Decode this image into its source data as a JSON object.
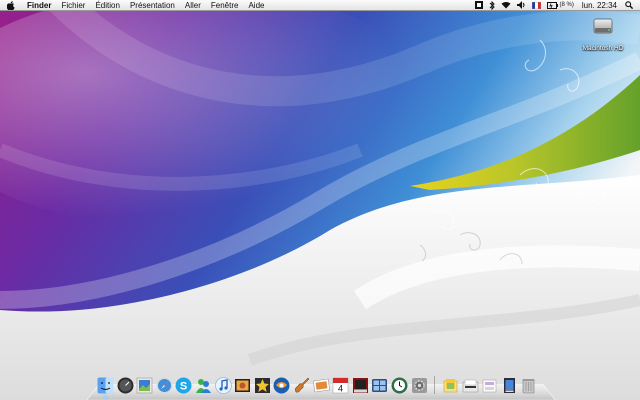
{
  "menubar": {
    "apple_icon": "apple-icon",
    "app_name": "Finder",
    "menus": [
      "Fichier",
      "Édition",
      "Présentation",
      "Aller",
      "Fenêtre",
      "Aide"
    ],
    "battery_text": "(8 %)",
    "clock": "lun. 22:34",
    "status_icons": [
      "scripts-icon",
      "bluetooth-icon",
      "wifi-icon",
      "volume-icon",
      "flag-fr-icon",
      "battery-icon",
      "spotlight-icon"
    ]
  },
  "desktop": {
    "icons": [
      {
        "label": "Macintosh HD",
        "icon": "hard-drive-icon"
      }
    ]
  },
  "dock": {
    "apps": [
      {
        "name": "finder-icon",
        "running": true
      },
      {
        "name": "dashboard-icon",
        "running": false
      },
      {
        "name": "preview-icon",
        "running": false
      },
      {
        "name": "safari-icon",
        "running": false
      },
      {
        "name": "skype-icon",
        "running": false
      },
      {
        "name": "messenger-icon",
        "running": false
      },
      {
        "name": "itunes-icon",
        "running": false
      },
      {
        "name": "iphoto-icon",
        "running": false
      },
      {
        "name": "imovie-icon",
        "running": false
      },
      {
        "name": "iweb-icon",
        "running": false
      },
      {
        "name": "garageband-icon",
        "running": false
      },
      {
        "name": "preview-photos-icon",
        "running": false
      },
      {
        "name": "ical-icon",
        "running": false,
        "badge": "4"
      },
      {
        "name": "photo-booth-icon",
        "running": false
      },
      {
        "name": "spaces-icon",
        "running": false
      },
      {
        "name": "time-machine-icon",
        "running": false
      },
      {
        "name": "system-preferences-icon",
        "running": false
      }
    ],
    "stacks": [
      {
        "name": "applications-stack-icon"
      },
      {
        "name": "documents-stack-icon"
      },
      {
        "name": "downloads-stack-icon"
      },
      {
        "name": "pages-stack-icon"
      },
      {
        "name": "trash-icon"
      }
    ],
    "accent_colors": {
      "wallpaper_purple": "#7b1f8f",
      "wallpaper_blue": "#2b6fc8",
      "wallpaper_green": "#7fae2a",
      "wallpaper_yellow": "#d9c21b"
    }
  }
}
